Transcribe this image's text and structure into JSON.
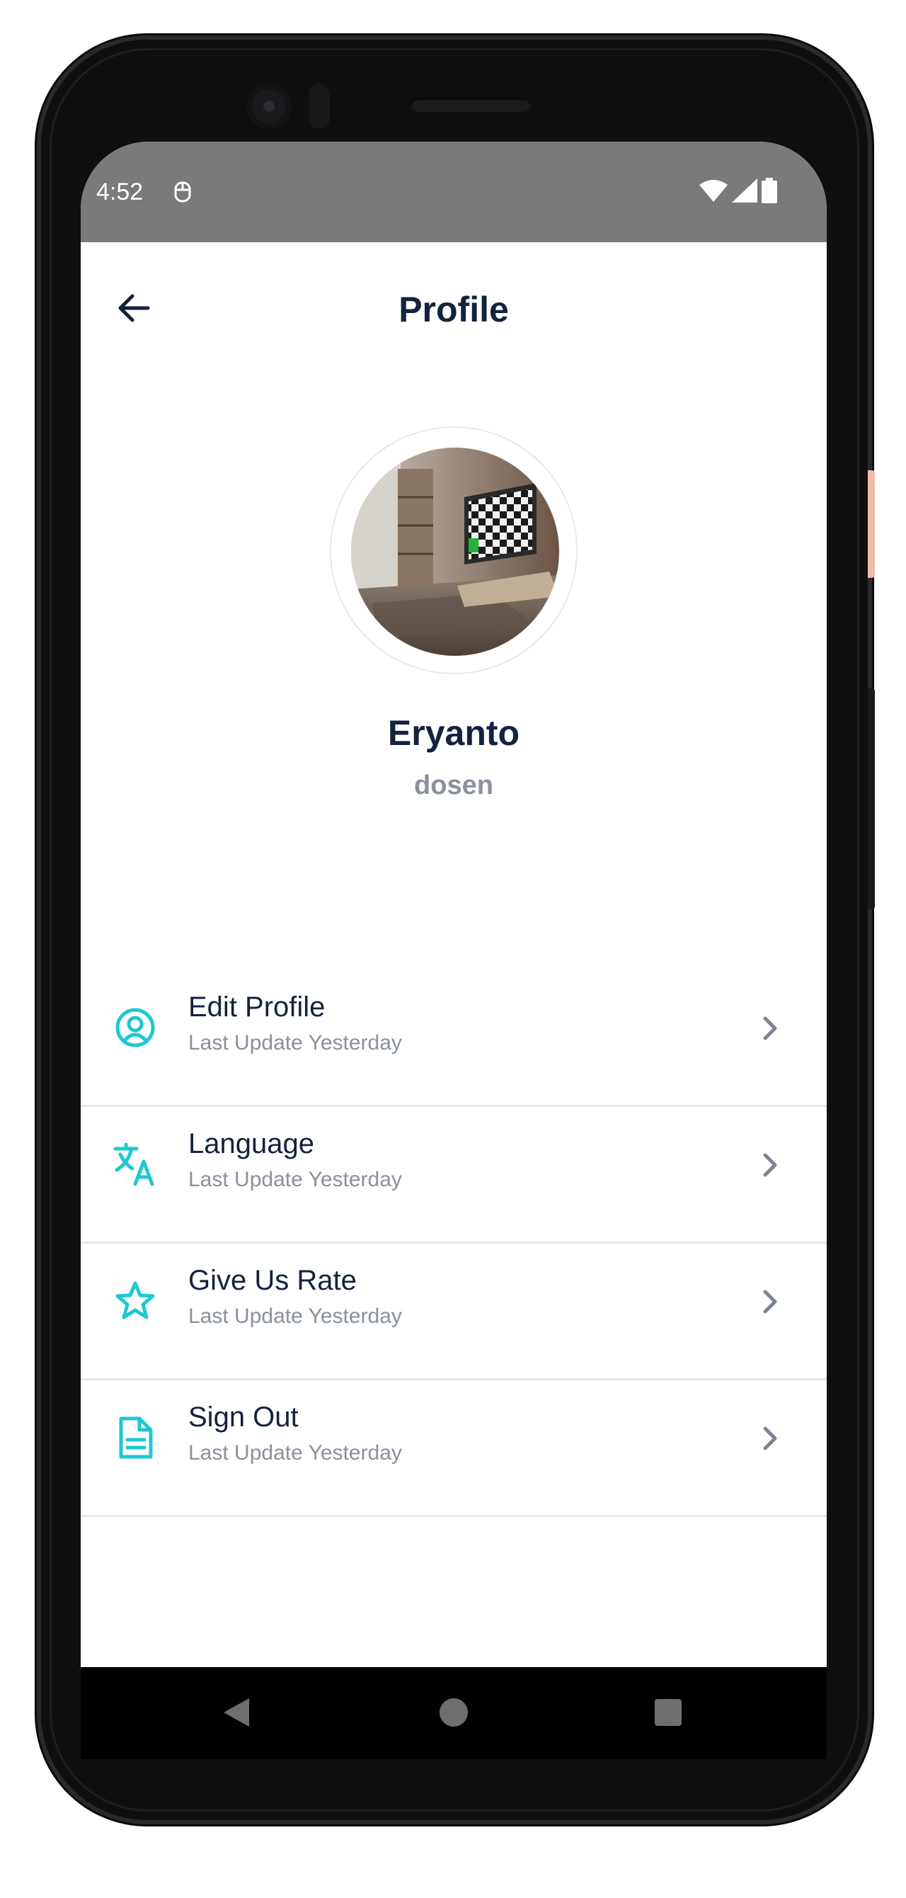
{
  "status_bar": {
    "time": "4:52",
    "icons": [
      "debug-icon",
      "wifi-icon",
      "signal-icon",
      "battery-icon"
    ]
  },
  "header": {
    "title": "Profile",
    "back_icon": "arrow-left-icon"
  },
  "profile": {
    "name": "Eryanto",
    "role": "dosen"
  },
  "menu": {
    "items": [
      {
        "label": "Edit Profile",
        "subtitle": "Last Update Yesterday",
        "icon": "user-circle-icon"
      },
      {
        "label": "Language",
        "subtitle": "Last Update Yesterday",
        "icon": "translate-icon"
      },
      {
        "label": "Give Us Rate",
        "subtitle": "Last Update Yesterday",
        "icon": "star-icon"
      },
      {
        "label": "Sign Out",
        "subtitle": "Last Update Yesterday",
        "icon": "document-icon"
      }
    ]
  },
  "nav_bar": {
    "buttons": [
      "back-triangle-icon",
      "home-circle-icon",
      "recents-square-icon"
    ]
  },
  "colors": {
    "accent": "#1ec8d2",
    "title_text": "#15223d",
    "muted_text": "#8a909c",
    "status_bar_bg": "#7a7a7a",
    "divider": "#e6e7ea",
    "chevron": "#7d8392"
  }
}
